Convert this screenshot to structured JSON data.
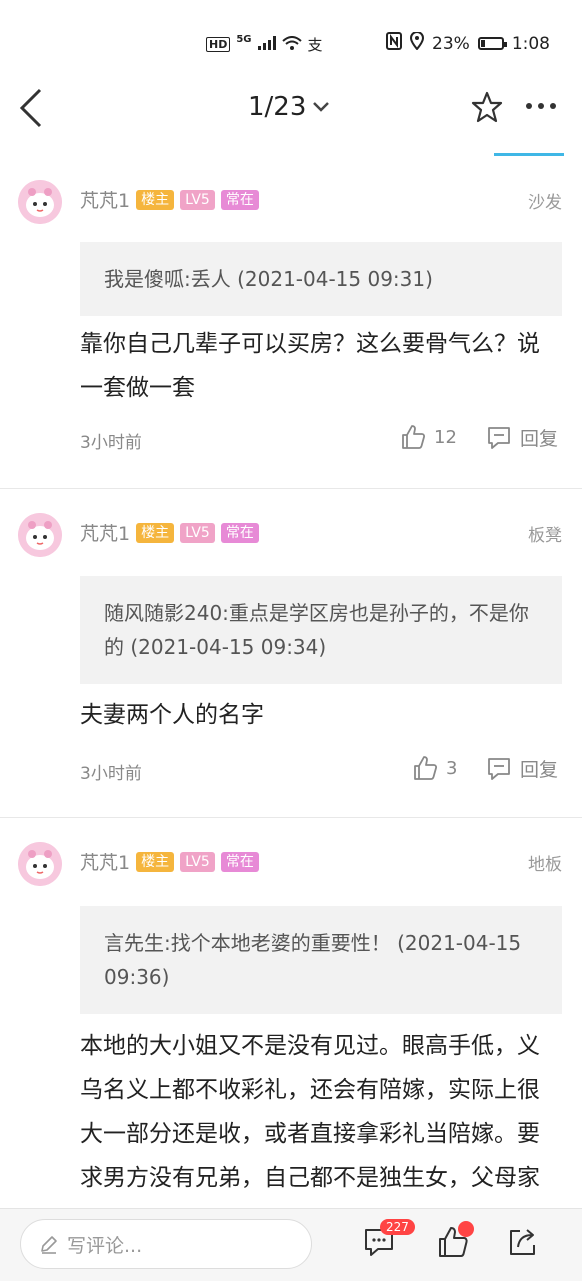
{
  "status": {
    "left_labels": [
      "HD",
      "5G"
    ],
    "battery": "23%",
    "battery_level": 0.23,
    "time": "1:08"
  },
  "nav": {
    "page": "1/23"
  },
  "posts": [
    {
      "user": "芃芃1",
      "badges": [
        "楼主",
        "LV5",
        "常在"
      ],
      "floor": "沙发",
      "quote": "我是傻呱:丢人 (2021-04-15 09:31)",
      "content": "靠你自己几辈子可以买房？这么要骨气么？说一套做一套",
      "time": "3小时前",
      "likes": "12",
      "reply": "回复"
    },
    {
      "user": "芃芃1",
      "badges": [
        "楼主",
        "LV5",
        "常在"
      ],
      "floor": "板凳",
      "quote": "随风随影240:重点是学区房也是孙子的，不是你的 (2021-04-15 09:34)",
      "content": "夫妻两个人的名字",
      "time": "3小时前",
      "likes": "3",
      "reply": "回复"
    },
    {
      "user": "芃芃1",
      "badges": [
        "楼主",
        "LV5",
        "常在"
      ],
      "floor": "地板",
      "quote": "言先生:找个本地老婆的重要性！ (2021-04-15 09:36)",
      "content": "本地的大小姐又不是没有见过。眼高手低，义乌名义上都不收彩礼，还会有陪嫁，实际上很大一部分还是收，或者直接拿彩礼当陪嫁。要求男方没有兄弟，自己都不是独生女，父母家底没有共"
    }
  ],
  "bottom": {
    "placeholder": "写评论...",
    "comment_count": "227"
  },
  "colors": {
    "accent": "#3fb7e6",
    "host_badge": "#f5b53d",
    "level_badge": "#f0a3c7",
    "regular_badge": "#e78ad6",
    "notification": "#ff4444"
  }
}
